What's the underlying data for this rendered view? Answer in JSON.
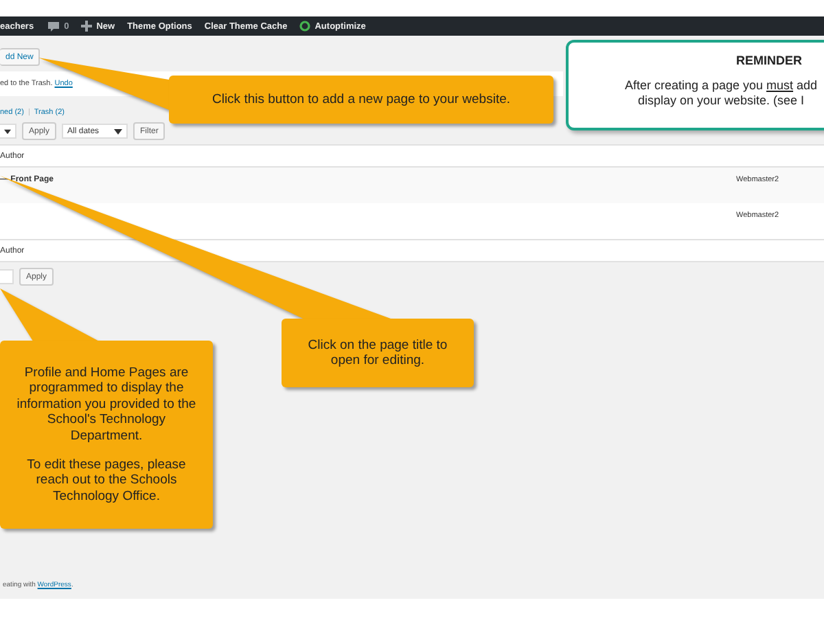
{
  "admin_bar": {
    "items": [
      {
        "kind": "text",
        "label": "eachers"
      },
      {
        "kind": "comments",
        "label": "0"
      },
      {
        "kind": "new",
        "label": "New"
      },
      {
        "kind": "text",
        "label": "Theme Options"
      },
      {
        "kind": "text",
        "label": "Clear Theme Cache"
      },
      {
        "kind": "status",
        "label": "Autoptimize"
      }
    ]
  },
  "add_new_button": "dd New",
  "notice": {
    "text": "ed to the Trash.",
    "link": "Undo"
  },
  "status_links": [
    {
      "label": "ned (2)"
    },
    {
      "label": "Trash (2)"
    }
  ],
  "status_separator": "|",
  "filters": {
    "apply": "Apply",
    "dates": "All dates",
    "filter": "Filter"
  },
  "table": {
    "author_header": "Author",
    "rows": [
      {
        "title": "— Front Page",
        "author": "Webmaster2"
      },
      {
        "title": "",
        "author": "Webmaster2"
      }
    ],
    "author_footer": "Author"
  },
  "bottom_apply": "Apply",
  "footer": {
    "text": "eating with ",
    "link": "WordPress",
    "after": "."
  },
  "callouts": [
    {
      "kind": "orange",
      "paragraphs": [
        "Click this button to add a new page to your website."
      ]
    },
    {
      "kind": "reminder",
      "title": "REMINDER",
      "lines": [
        {
          "before": "After creating a page you ",
          "emphasis": "must",
          "after": " add"
        },
        {
          "before": "display on your website. (see I"
        }
      ]
    },
    {
      "kind": "orange",
      "paragraphs": [
        "Profile and Home Pages are programmed to display the information you provided to the School's Technology Department.",
        "To edit these pages, please reach out to the Schools Technology Office."
      ]
    },
    {
      "kind": "orange",
      "paragraphs": [
        "Click on the page title to open for editing."
      ]
    }
  ]
}
